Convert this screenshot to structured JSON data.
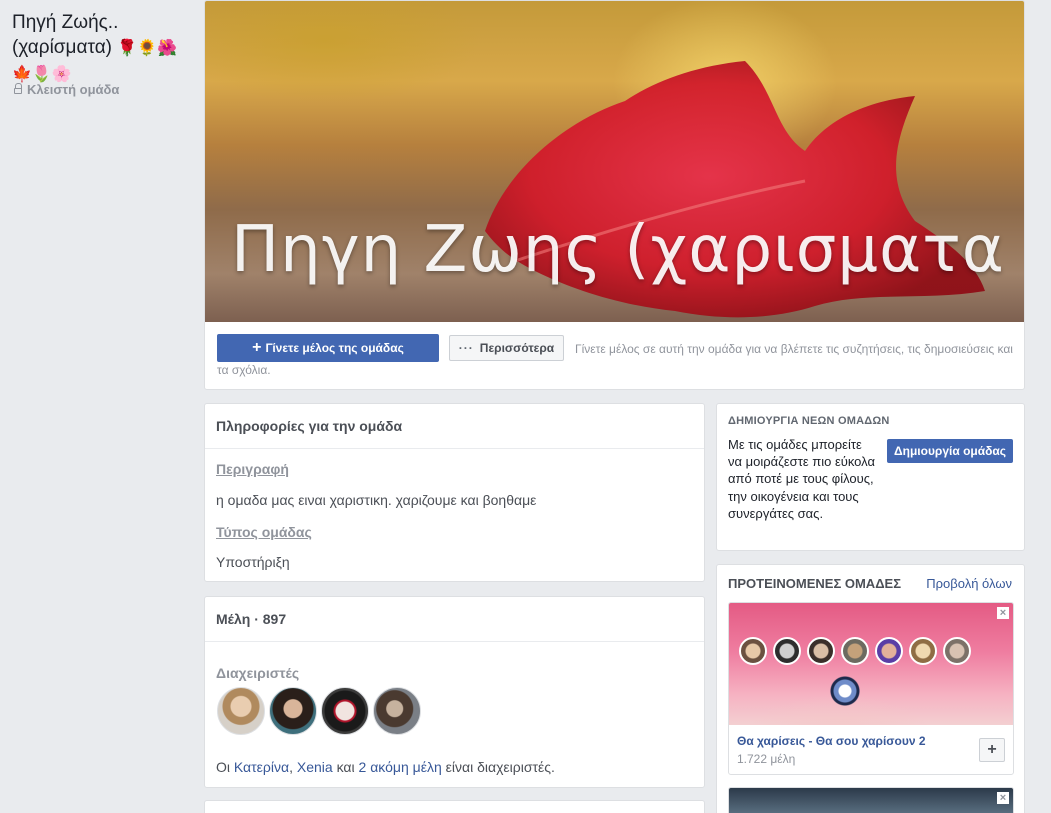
{
  "group": {
    "title": "Πηγή Ζωής.. (χαρίσματα)",
    "title_emoji_line1": "🌹🌻🌺",
    "title_emoji_line2": "🍁🌷🌸",
    "privacy": "Κλειστή ομάδα",
    "cover_text": "Πηγη Ζωης (χαρισματα )"
  },
  "actions": {
    "join_label": "Γίνετε μέλος της ομάδας",
    "more_label": "Περισσότερα",
    "join_hint": "Γίνετε μέλος σε αυτή την ομάδα για να βλέπετε τις συζητήσεις, τις δημοσιεύσεις και τα σχόλια."
  },
  "about": {
    "header": "Πληροφορίες για την ομάδα",
    "description_label": "Περιγραφή",
    "description": "η ομαδα μας ειναι χαριστικη. χαριζουμε και βοηθαμε",
    "type_label": "Τύπος ομάδας",
    "type": "Υποστήριξη"
  },
  "members": {
    "header": "Μέλη · 897",
    "admins_label": "Διαχειριστές",
    "admin_prefix": "Οι",
    "admin1": "Κατερίνα",
    "separator": ",",
    "admin2": "Xenia",
    "and": "και",
    "more_link": "2 ακόμη μέλη",
    "suffix": "είναι διαχειριστές."
  },
  "create_groups": {
    "title": "ΔΗΜΙΟΥΡΓΙΑ ΝΕΩΝ ΟΜΑΔΩΝ",
    "text": "Με τις ομάδες μπορείτε να μοιράζεστε πιο εύκολα από ποτέ με τους φίλους, την οικογένεια και τους συνεργάτες σας.",
    "button": "Δημιουργία ομάδας"
  },
  "suggested": {
    "title": "ΠΡΟΤΕΙΝΟΜΕΝΕΣ ΟΜΑΔΕΣ",
    "see_all": "Προβολή όλων",
    "items": [
      {
        "name": "Θα χαρίσεις - Θα σου χαρίσουν 2",
        "members": "1.722 μέλη"
      }
    ]
  },
  "icons": {
    "lock": "lock-icon",
    "plus": "plus-icon",
    "more": "ellipsis-icon",
    "close": "close-icon",
    "add": "add-icon"
  },
  "colors": {
    "primary": "#4267b2",
    "link": "#385898",
    "background": "#e9ebee",
    "muted": "#90949c"
  }
}
